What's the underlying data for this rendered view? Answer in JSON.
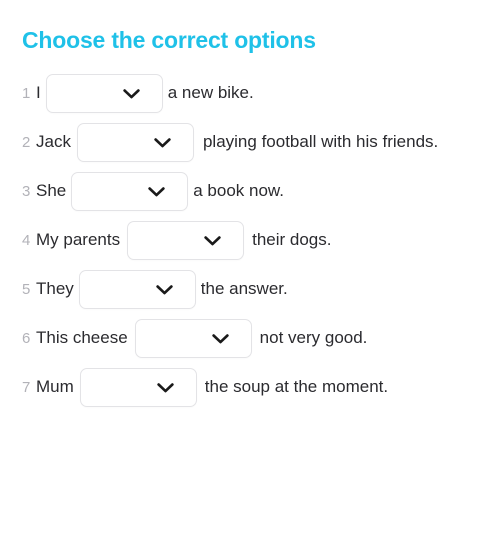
{
  "title": "Choose the correct options",
  "accent_color": "#1fc1e8",
  "text_color": "#2b2b2f",
  "number_color": "#b2b2b8",
  "select_border_color": "#e3e3e6",
  "background_color": "#ffffff",
  "select": {
    "icon": "chevron-down-icon",
    "value": "",
    "placeholder": ""
  },
  "questions": [
    {
      "number": "1",
      "before": "I",
      "answer": "",
      "after": "a new bike."
    },
    {
      "number": "2",
      "before": "Jack",
      "answer": "",
      "after": "playing football with his friends."
    },
    {
      "number": "3",
      "before": "She",
      "answer": "",
      "after": "a book now."
    },
    {
      "number": "4",
      "before": "My parents",
      "answer": "",
      "after": "their dogs."
    },
    {
      "number": "5",
      "before": "They",
      "answer": "",
      "after": "the answer."
    },
    {
      "number": "6",
      "before": "This cheese",
      "answer": "",
      "after": "not very good."
    },
    {
      "number": "7",
      "before": "Mum",
      "answer": "",
      "after": "the soup at the moment."
    }
  ]
}
